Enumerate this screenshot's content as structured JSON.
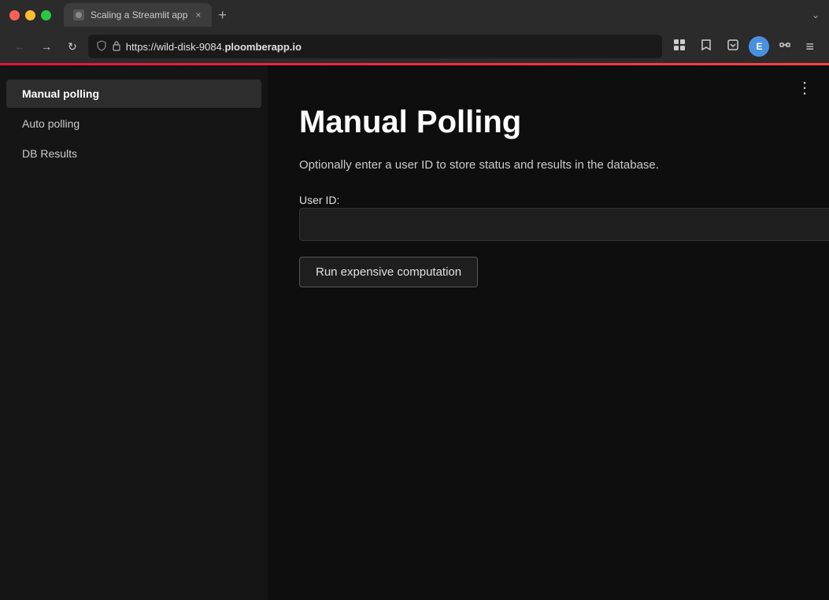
{
  "browser": {
    "window_controls": {
      "close_label": "",
      "minimize_label": "",
      "maximize_label": ""
    },
    "tab": {
      "favicon_alt": "streamlit-favicon",
      "title": "Scaling a Streamlit app",
      "close_label": "×"
    },
    "new_tab_label": "+",
    "tab_expand_label": "⌄",
    "nav": {
      "back_label": "←",
      "forward_label": "→",
      "refresh_label": "↻",
      "url_prefix": "https://wild-disk-9084.",
      "url_domain": "ploomberapp.io",
      "shield_icon": "🛡",
      "lock_icon": "🔒"
    },
    "toolbar": {
      "grid_icon": "⊞",
      "star_icon": "☆",
      "pocket_icon": "⬇",
      "profile_label": "E",
      "extensions_icon": "🧩",
      "menu_icon": "≡"
    }
  },
  "sidebar": {
    "items": [
      {
        "label": "Manual polling",
        "active": true
      },
      {
        "label": "Auto polling",
        "active": false
      },
      {
        "label": "DB Results",
        "active": false
      }
    ]
  },
  "main": {
    "more_icon_label": "⋮",
    "title": "Manual Polling",
    "description": "Optionally enter a user ID to store status and results in the database.",
    "user_id_label": "User ID:",
    "user_id_placeholder": "",
    "run_button_label": "Run expensive computation"
  }
}
